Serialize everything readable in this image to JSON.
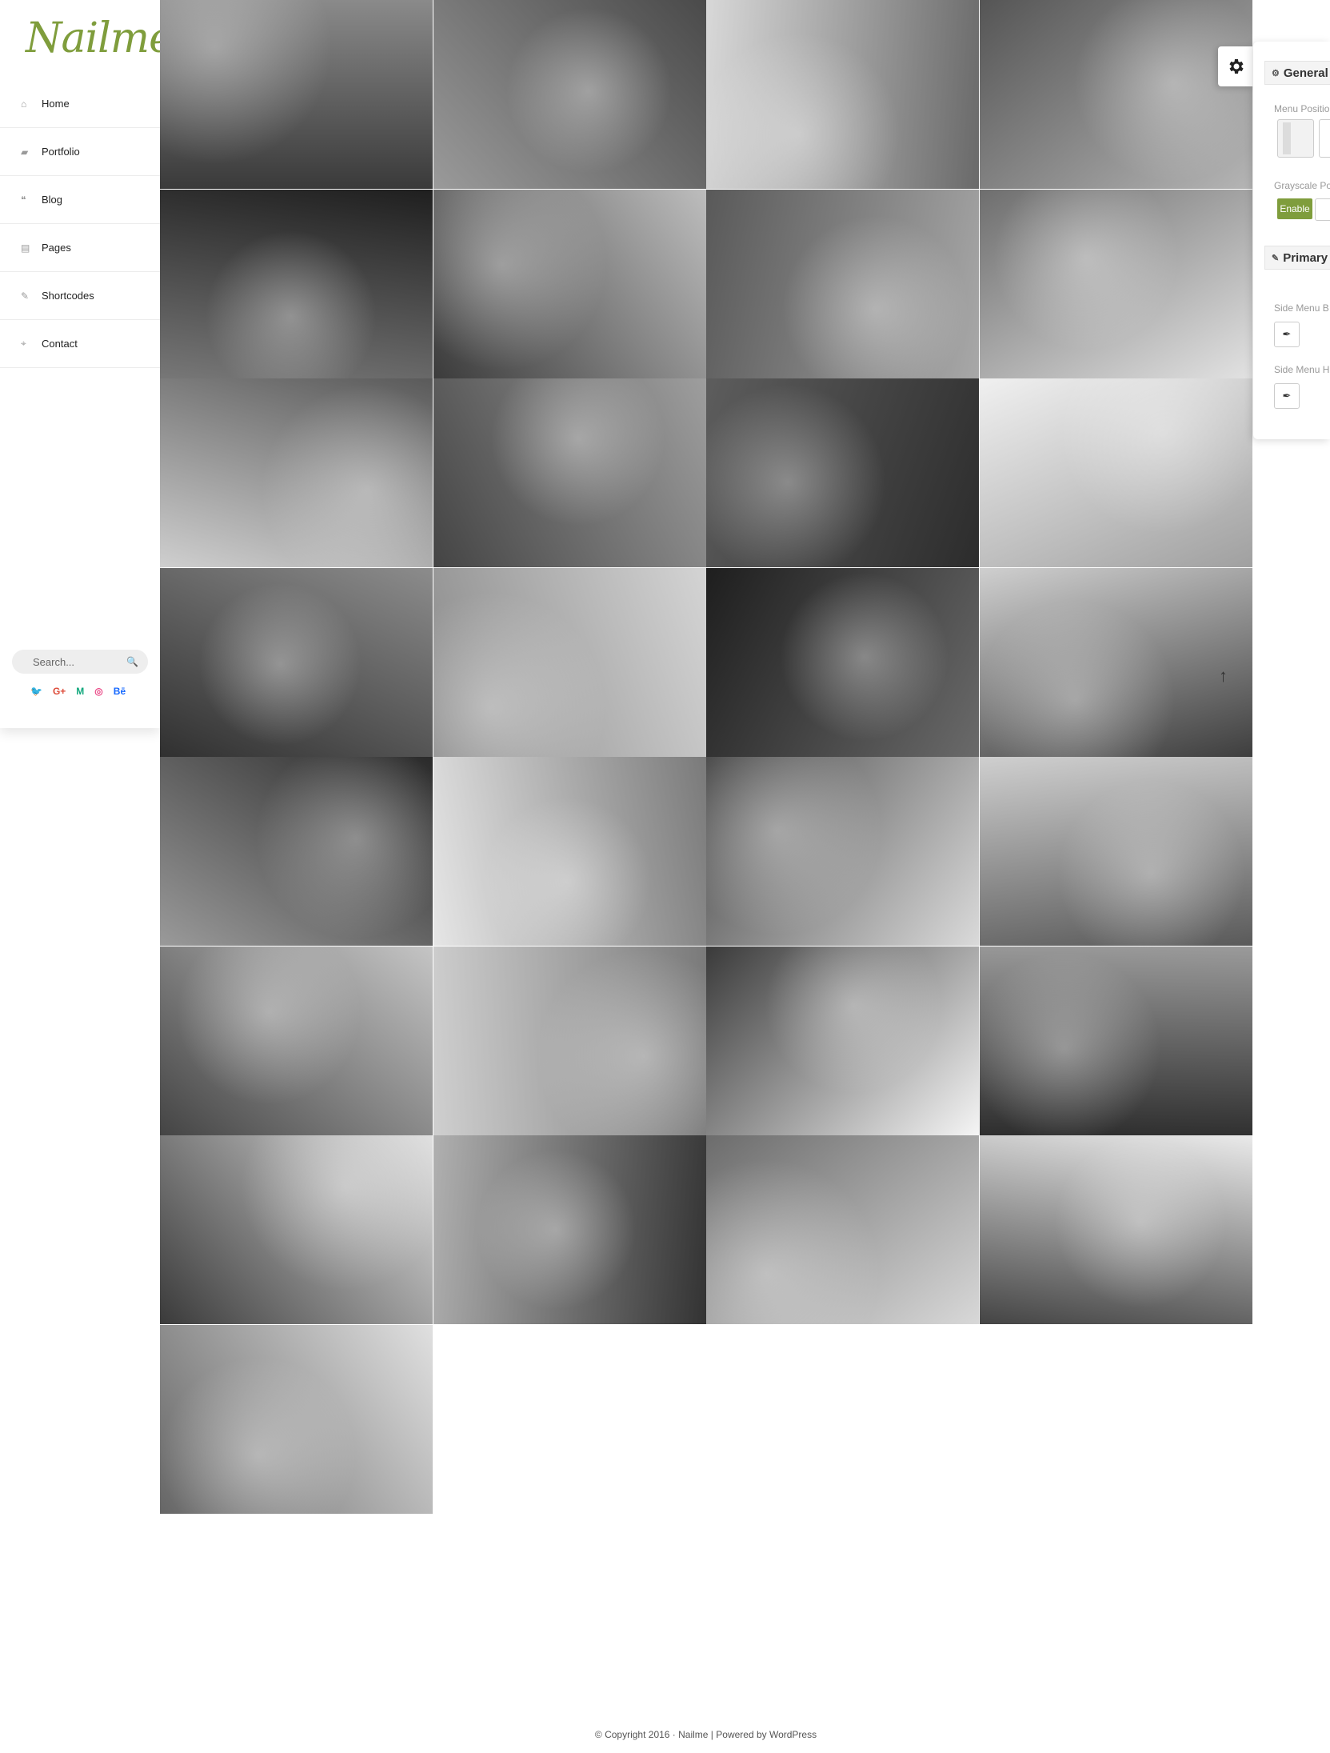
{
  "brand": {
    "logo": "Nailme",
    "accent": "#7f9d3c"
  },
  "nav": {
    "items": [
      {
        "label": "Home",
        "icon": "home-icon"
      },
      {
        "label": "Portfolio",
        "icon": "folder-icon"
      },
      {
        "label": "Blog",
        "icon": "quote-icon"
      },
      {
        "label": "Pages",
        "icon": "pages-icon"
      },
      {
        "label": "Shortcodes",
        "icon": "pin-icon"
      },
      {
        "label": "Contact",
        "icon": "location-icon"
      }
    ]
  },
  "search": {
    "placeholder": "Search..."
  },
  "social": {
    "icons": [
      {
        "name": "twitter-icon",
        "glyph": "🐦",
        "color": "#55acee"
      },
      {
        "name": "google-plus-icon",
        "glyph": "G+",
        "color": "#dd4b39"
      },
      {
        "name": "medium-icon",
        "glyph": "M",
        "color": "#12a87d"
      },
      {
        "name": "dribbble-icon",
        "glyph": "◎",
        "color": "#ea4c89"
      },
      {
        "name": "behance-icon",
        "glyph": "Bē",
        "color": "#1769ff"
      }
    ]
  },
  "settings_panel": {
    "general_title": "General",
    "menu_position_label": "Menu Position",
    "grayscale_label": "Grayscale Po",
    "enable_label": "Enable",
    "primary_title": "Primary",
    "side_menu_bg_label": "Side Menu B",
    "side_menu_hover_label": "Side Menu H"
  },
  "gallery": {
    "photo_count": 29
  },
  "footer": {
    "text": "© Copyright 2016 · Nailme | Powered by WordPress"
  }
}
